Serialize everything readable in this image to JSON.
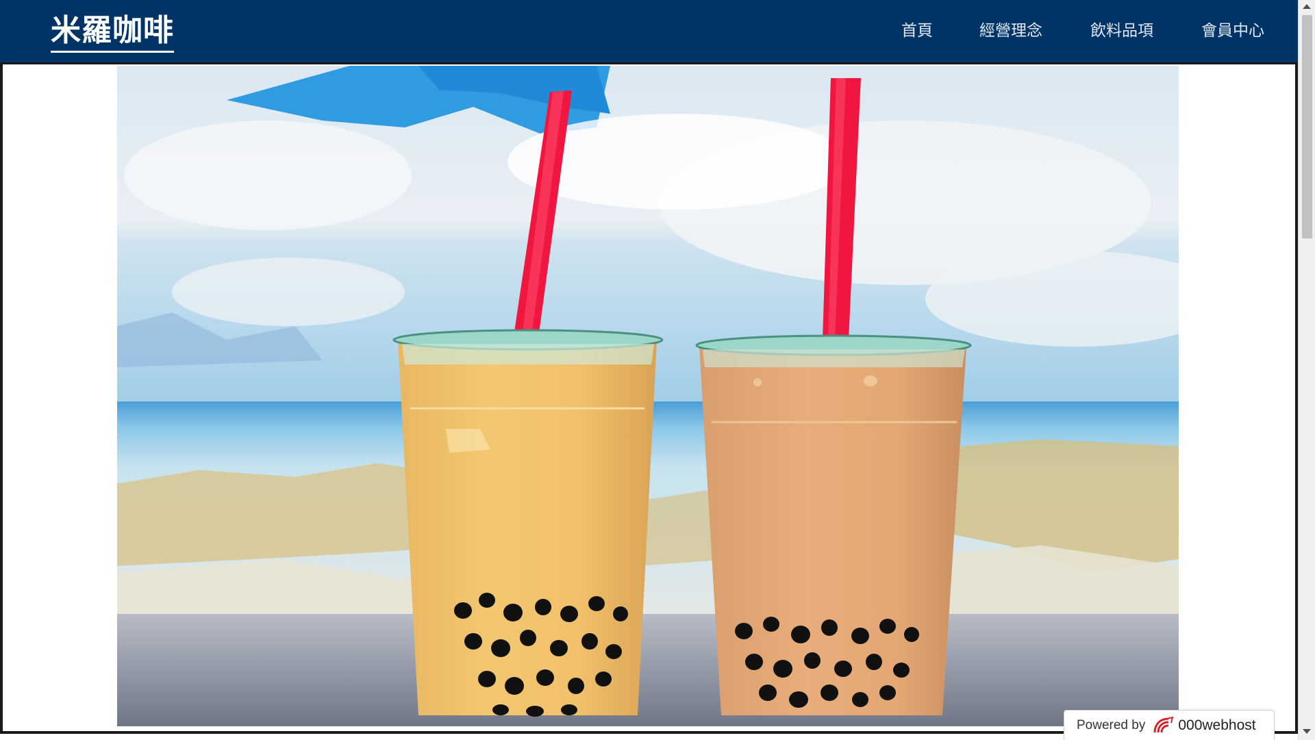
{
  "header": {
    "brand": "米羅咖啡",
    "nav": [
      {
        "label": "首頁"
      },
      {
        "label": "經營理念"
      },
      {
        "label": "飲料品項"
      },
      {
        "label": "會員中心"
      }
    ]
  },
  "hero": {
    "image": "bubble-tea-photo",
    "description": "two-bubble-tea-cups-by-the-sea"
  },
  "footer_badge": {
    "prefix": "Powered by",
    "brand": "000webhost",
    "logo_icon": "000webhost-logo-icon"
  },
  "colors": {
    "navbar": "#003366",
    "nav_text": "#e2e8f2",
    "straw": "#f0163f",
    "sky": "#3fa9e6"
  }
}
